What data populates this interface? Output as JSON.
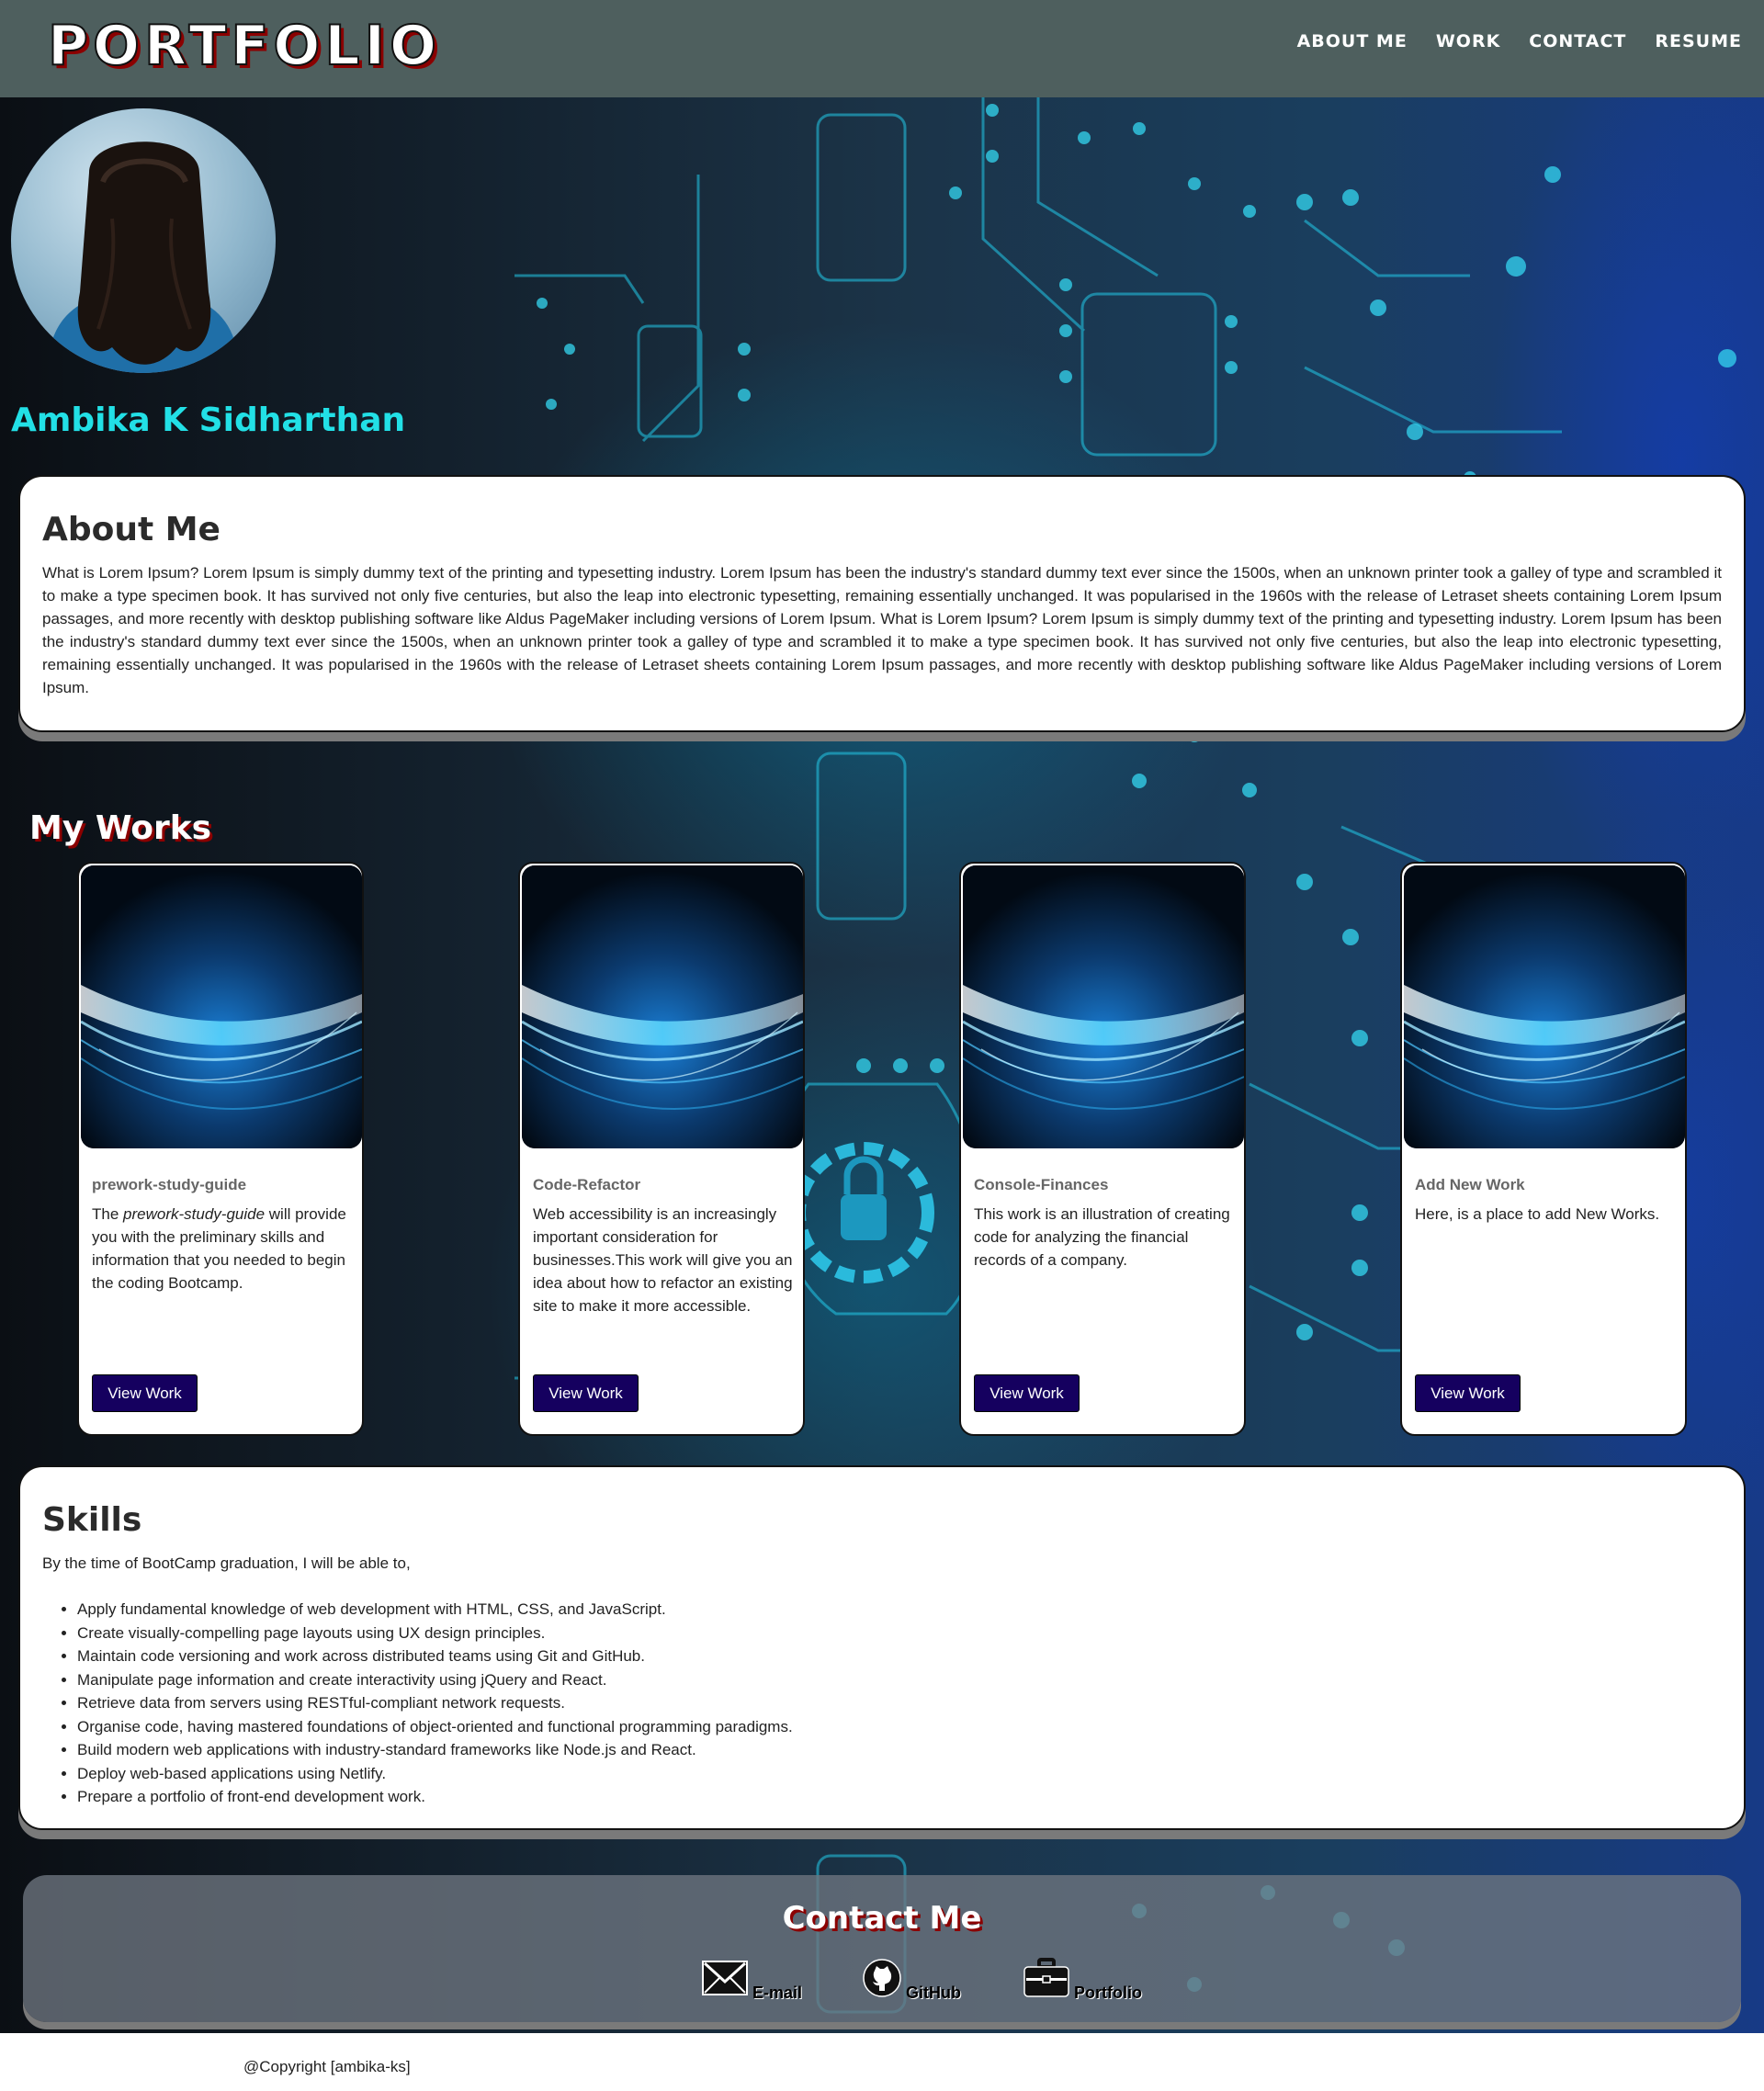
{
  "header": {
    "logo": "PORTFOLIO",
    "nav": [
      "ABOUT ME",
      "WORK",
      "CONTACT",
      "RESUME"
    ]
  },
  "hero": {
    "name": "Ambika K Sidharthan"
  },
  "about": {
    "title": "About Me",
    "text": "What is Lorem Ipsum? Lorem Ipsum is simply dummy text of the printing and typesetting industry. Lorem Ipsum has been the industry's standard dummy text ever since the 1500s, when an unknown printer took a galley of type and scrambled it to make a type specimen book. It has survived not only five centuries, but also the leap into electronic typesetting, remaining essentially unchanged. It was popularised in the 1960s with the release of Letraset sheets containing Lorem Ipsum passages, and more recently with desktop publishing software like Aldus PageMaker including versions of Lorem Ipsum. What is Lorem Ipsum? Lorem Ipsum is simply dummy text of the printing and typesetting industry. Lorem Ipsum has been the industry's standard dummy text ever since the 1500s, when an unknown printer took a galley of type and scrambled it to make a type specimen book. It has survived not only five centuries, but also the leap into electronic typesetting, remaining essentially unchanged. It was popularised in the 1960s with the release of Letraset sheets containing Lorem Ipsum passages, and more recently with desktop publishing software like Aldus PageMaker including versions of Lorem Ipsum."
  },
  "works": {
    "title": "My Works",
    "items": [
      {
        "title": "prework-study-guide",
        "desc_before": "The ",
        "desc_em": "prework-study-guide",
        "desc_after": " will provide you with the preliminary skills and information that you needed to begin the coding Bootcamp.",
        "button": "View Work"
      },
      {
        "title": "Code-Refactor",
        "desc": "Web accessibility is an increasingly important consideration for businesses.This work will give you an idea about how to refactor an existing site to make it more accessible.",
        "button": "View Work"
      },
      {
        "title": "Console-Finances",
        "desc": "This work is an illustration of creating code for analyzing the financial records of a company.",
        "button": "View Work"
      },
      {
        "title": "Add New Work",
        "desc": "Here, is a place to add New Works.",
        "button": "View Work"
      }
    ]
  },
  "skills": {
    "title": "Skills",
    "intro": "By the time of BootCamp graduation, I will be able to,",
    "items": [
      "Apply fundamental knowledge of web development with HTML, CSS, and JavaScript.",
      "Create visually-compelling page layouts using UX design principles.",
      "Maintain code versioning and work across distributed teams using Git and GitHub.",
      "Manipulate page information and create interactivity using jQuery and React.",
      "Retrieve data from servers using RESTful-compliant network requests.",
      "Organise code, having mastered foundations of object-oriented and functional programming paradigms.",
      "Build modern web applications with industry-standard frameworks like Node.js and React.",
      "Deploy web-based applications using Netlify.",
      "Prepare a portfolio of front-end development work."
    ]
  },
  "contact": {
    "title": "Contact Me",
    "email": "E-mail",
    "github": "GitHub",
    "portfolio": "Portfolio"
  },
  "footer": {
    "copyright": "@Copyright [ambika-ks]"
  },
  "colors": {
    "header_bg": "#4e5f5e",
    "name_accent": "#22e0e6",
    "button_bg": "#15005f",
    "title_shadow": "#8b0000"
  },
  "icons": [
    "envelope-icon",
    "github-icon",
    "briefcase-icon"
  ]
}
